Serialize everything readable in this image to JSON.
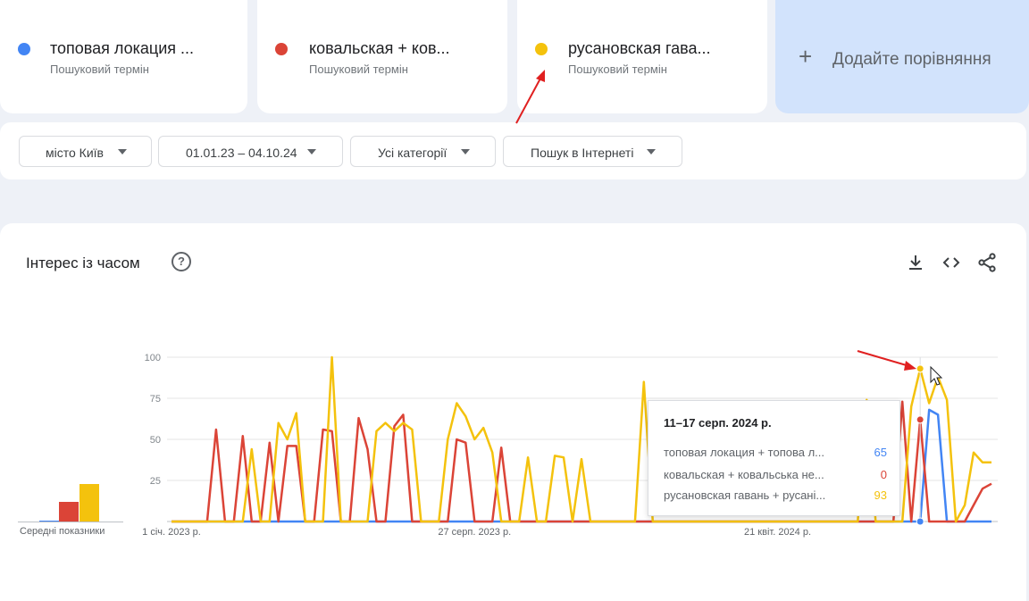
{
  "terms": [
    {
      "name": "топовая локация ...",
      "sub": "Пошуковий термін",
      "color": "#4285f4"
    },
    {
      "name": "ковальская + ков...",
      "sub": "Пошуковий термін",
      "color": "#db4437"
    },
    {
      "name": "русановская гава...",
      "sub": "Пошуковий термін",
      "color": "#f4c20d"
    }
  ],
  "add_compare": {
    "icon": "plus-icon",
    "label": "Додайте порівняння"
  },
  "filters": {
    "location": "місто Київ",
    "date_range": "01.01.23 – 04.10.24",
    "category": "Усі категорії",
    "search_type": "Пошук в Інтернеті"
  },
  "panel": {
    "title": "Інтерес із часом",
    "help_icon": "?",
    "tool_icons": [
      "download-icon",
      "embed-code-icon",
      "share-icon"
    ]
  },
  "averages": {
    "label": "Середні показники",
    "values": [
      0.5,
      12,
      23
    ]
  },
  "tooltip": {
    "title": "11–17 серп. 2024 р.",
    "rows": [
      {
        "name": "топовая локация + топова л...",
        "value": "65"
      },
      {
        "name": "ковальская + ковальська не...",
        "value": "0"
      },
      {
        "name": "русановская гавань + русані...",
        "value": "93"
      }
    ]
  },
  "chart_data": {
    "type": "line",
    "title": "Інтерес із часом",
    "ylim": [
      0,
      100
    ],
    "yticks": [
      "25",
      "50",
      "75",
      "100"
    ],
    "xtick_labels": [
      "1 січ. 2023 р.",
      "27 серп. 2023 р.",
      "21 квіт. 2024 р."
    ],
    "xtick_weeks": [
      0,
      34,
      68
    ],
    "grid": true,
    "series": [
      {
        "name": "топовая локация + топова л...",
        "color": "#4285f4",
        "values": [
          0,
          0,
          0,
          0,
          0,
          0,
          0,
          0,
          0,
          0,
          0,
          0,
          0,
          0,
          0,
          0,
          0,
          0,
          0,
          0,
          0,
          0,
          0,
          0,
          0,
          0,
          0,
          0,
          0,
          0,
          0,
          0,
          0,
          0,
          0,
          0,
          0,
          0,
          0,
          0,
          0,
          0,
          0,
          0,
          0,
          0,
          0,
          0,
          0,
          0,
          0,
          0,
          0,
          0,
          0,
          0,
          0,
          0,
          0,
          0,
          0,
          0,
          0,
          0,
          0,
          0,
          0,
          0,
          0,
          0,
          0,
          0,
          0,
          0,
          0,
          0,
          0,
          0,
          0,
          0,
          0,
          0,
          0,
          0,
          0,
          68,
          65,
          0,
          0,
          0,
          0,
          0,
          0
        ]
      },
      {
        "name": "ковальская + ковальська не...",
        "color": "#db4437",
        "values": [
          0,
          0,
          0,
          0,
          0,
          56,
          0,
          0,
          52,
          0,
          0,
          48,
          0,
          46,
          46,
          0,
          0,
          56,
          55,
          0,
          0,
          63,
          44,
          0,
          0,
          58,
          65,
          0,
          0,
          0,
          0,
          0,
          50,
          48,
          0,
          0,
          0,
          45,
          0,
          0,
          0,
          0,
          0,
          0,
          0,
          0,
          0,
          0,
          0,
          0,
          0,
          0,
          0,
          0,
          0,
          0,
          0,
          0,
          0,
          0,
          0,
          0,
          0,
          0,
          0,
          0,
          0,
          0,
          0,
          0,
          0,
          0,
          0,
          0,
          0,
          0,
          0,
          0,
          0,
          0,
          0,
          0,
          73,
          0,
          62,
          0,
          0,
          0,
          0,
          0,
          10,
          20,
          23
        ]
      },
      {
        "name": "русановская гавань + русані...",
        "color": "#f4c20d",
        "values": [
          0,
          0,
          0,
          0,
          0,
          0,
          0,
          0,
          0,
          44,
          0,
          0,
          60,
          50,
          66,
          0,
          0,
          0,
          100,
          0,
          0,
          0,
          0,
          55,
          60,
          55,
          60,
          56,
          0,
          0,
          0,
          50,
          72,
          64,
          50,
          57,
          42,
          0,
          0,
          0,
          39,
          0,
          0,
          40,
          39,
          0,
          38,
          0,
          0,
          0,
          0,
          0,
          0,
          85,
          0,
          0,
          0,
          0,
          0,
          0,
          0,
          0,
          0,
          0,
          0,
          0,
          0,
          0,
          0,
          0,
          0,
          0,
          0,
          0,
          0,
          0,
          0,
          0,
          74,
          0,
          0,
          0,
          0,
          70,
          93,
          72,
          88,
          74,
          0,
          10,
          42,
          36,
          36
        ]
      }
    ]
  }
}
